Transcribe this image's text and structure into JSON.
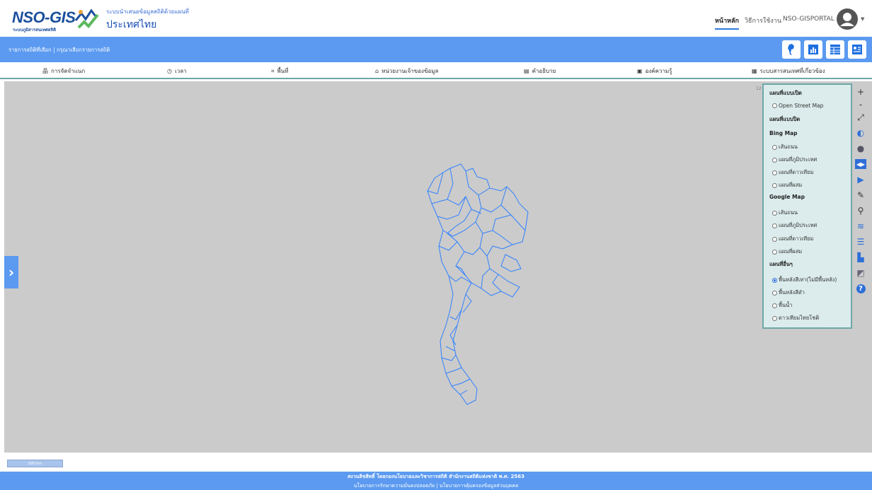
{
  "header": {
    "logo_text": "NSO-GIS",
    "logo_subtext": "ระบบภูมิสารสนเทศสถิติ",
    "tagline": "ระบบนำเสนอข้อมูลสถิติด้วยแผนที่",
    "country": "ประเทศไทย",
    "nav": [
      "หน้าหลัก",
      "วิธีการใช้งาน",
      "NSO-GISPORTAL"
    ]
  },
  "selection_bar": {
    "label": "รายการสถิติที่เลือก",
    "hint": "กรุณาเลือกรายการสถิติ"
  },
  "menu": [
    "การจัดจำแนก",
    "เวลา",
    "พื้นที่",
    "หน่วยงานเจ้าของข้อมูล",
    "คำอธิบาย",
    "องค์ความรู้",
    "ระบบสารสนเทศที่เกี่ยวข้อง"
  ],
  "scale_label": "12",
  "basemap_panel": {
    "open_title": "แผนที่แบบเปิด",
    "open_options": [
      "Open Street Map"
    ],
    "closed_title": "แผนที่แบบปิด",
    "bing_title": "Bing Map",
    "bing_options": [
      "เส้นถนน",
      "แผนที่ภูมิประเทศ",
      "แผนที่ดาวเทียม",
      "แผนที่ผสม"
    ],
    "google_title": "Google Map",
    "google_options": [
      "เส้นถนน",
      "แผนที่ภูมิประเทศ",
      "แผนที่ดาวเทียม",
      "แผนที่ผสม"
    ],
    "other_title": "แผนที่อื่นๆ",
    "other_options": [
      "พื้นหลังสีเทา(ไม่มีพื้นหลัง)",
      "พื้นหลังสีดำ",
      "พื้นน้ำ",
      "ดาวเทียมไทยโชติ"
    ],
    "selected": "พื้นหลังสีเทา(ไม่มีพื้นหลัง)"
  },
  "map_controls": [
    "+",
    "-",
    "⤢"
  ],
  "scalebar": "500 km",
  "footer": {
    "line1": "สงวนลิขสิทธิ์ โดยกองนโยบายและวิชาการสถิติ สำนักงานสถิติแห่งชาติ พ.ศ. 2563",
    "line2": "นโยบายการรักษาความมั่นคงปลอดภัย | นโยบายการคุ้มครองข้อมูลส่วนบุคคล"
  },
  "colors": {
    "accent": "#5b9af0",
    "border": "#6fa7a8",
    "map_bg": "#cbcbcb",
    "boundary": "#2f80ff"
  }
}
